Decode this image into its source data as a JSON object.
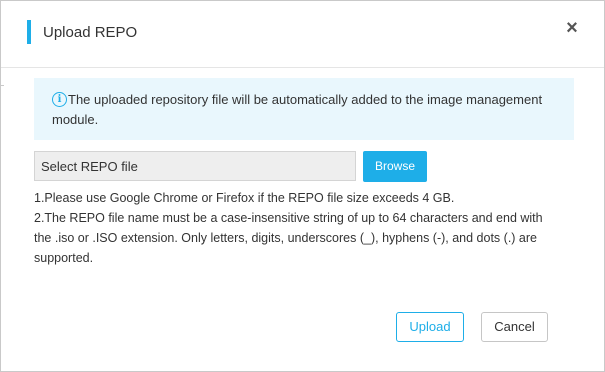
{
  "dialog": {
    "title": "Upload REPO",
    "close_symbol": "×",
    "close_icon": "close-icon",
    "accent_color": "#1eaee8"
  },
  "info": {
    "icon_symbol": "i",
    "icon": "info-icon",
    "text": "The uploaded repository file will be automatically added to the image management module."
  },
  "file": {
    "placeholder": "Select REPO file",
    "browse_label": "Browse"
  },
  "notes": {
    "line1": "1.Please use Google Chrome or Firefox if the REPO file size exceeds 4 GB.",
    "line2": "2.The REPO file name must be a case-insensitive string of up to 64 characters and end with the .iso or .ISO extension. Only letters, digits, underscores (_), hyphens (-), and dots (.) are supported."
  },
  "footer": {
    "upload_label": "Upload",
    "cancel_label": "Cancel"
  }
}
